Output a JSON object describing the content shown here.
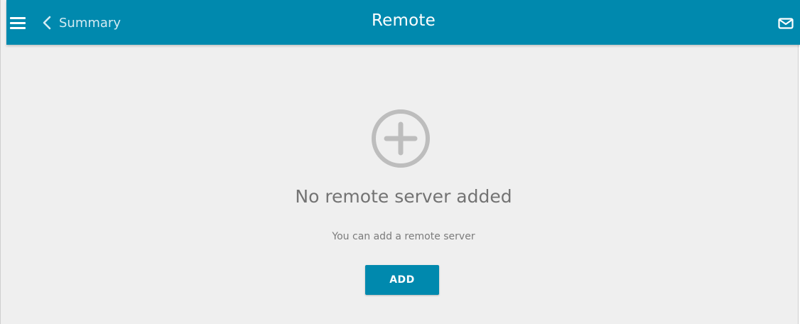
{
  "header": {
    "back_label": "Summary",
    "title": "Remote",
    "menu_icon": "hamburger-menu-icon",
    "back_icon": "chevron-left-icon",
    "mail_icon": "mail-icon"
  },
  "empty_state": {
    "icon": "add-circle-icon",
    "title": "No remote server added",
    "subtitle": "You can add a remote server",
    "button_label": "ADD"
  },
  "colors": {
    "header_bg": "#0089ae",
    "page_bg": "#efefef",
    "button_bg": "#0089ae",
    "plus_icon": "#bdbdbd"
  }
}
